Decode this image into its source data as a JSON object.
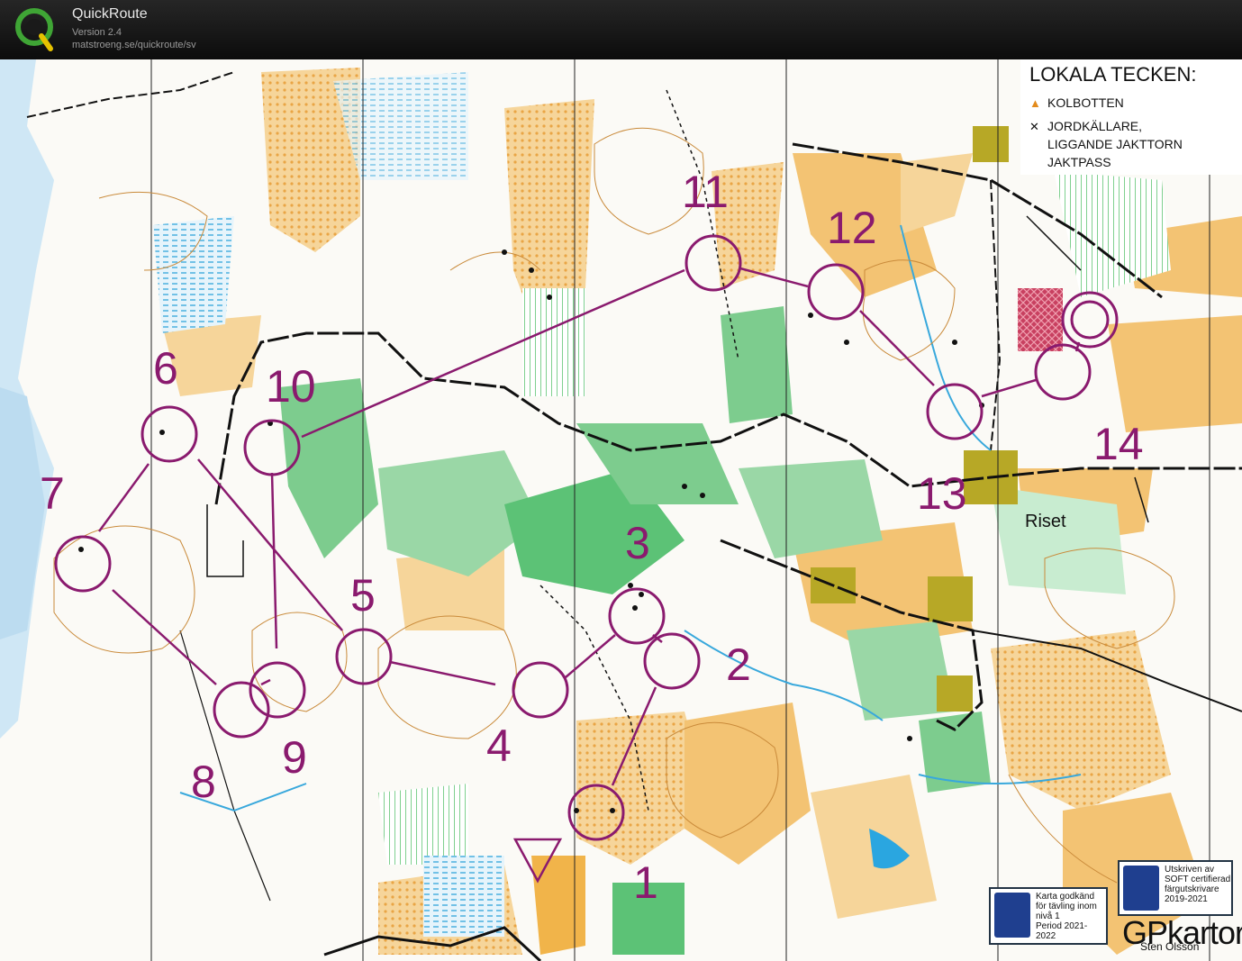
{
  "app": {
    "name": "QuickRoute",
    "version": "Version 2.4",
    "url": "matstroeng.se/quickroute/sv"
  },
  "legend": {
    "title": "LOKALA TECKEN:",
    "items": [
      {
        "symbol": "▲",
        "label": "KOLBOTTEN"
      },
      {
        "symbol": "✕",
        "label": "JORDKÄLLARE,"
      },
      {
        "symbol": "",
        "label": "LIGGANDE JAKTTORN"
      },
      {
        "symbol": "",
        "label": "JAKTPASS"
      }
    ]
  },
  "place_label": "Riset",
  "badges": {
    "left": [
      "Karta godkänd",
      "för tävling inom",
      "nivå 1",
      "Period 2021-2022"
    ],
    "right": [
      "Utskriven av",
      "SOFT certifierad",
      "färgutskrivare",
      "2019-2021"
    ]
  },
  "maker": {
    "logo": "GPkartor",
    "name": "Sten Olsson"
  },
  "course": {
    "color": "#8a1a6e",
    "controls": [
      {
        "label": "1"
      },
      {
        "label": "2"
      },
      {
        "label": "3"
      },
      {
        "label": "4"
      },
      {
        "label": "5"
      },
      {
        "label": "6"
      },
      {
        "label": "7"
      },
      {
        "label": "8"
      },
      {
        "label": "9"
      },
      {
        "label": "10"
      },
      {
        "label": "11"
      },
      {
        "label": "12"
      },
      {
        "label": "13"
      },
      {
        "label": "14"
      }
    ]
  },
  "colors": {
    "open_land": "#f3c373",
    "forest_green": "#5cc276",
    "water": "#b8dff5",
    "course": "#8a1a6e"
  }
}
